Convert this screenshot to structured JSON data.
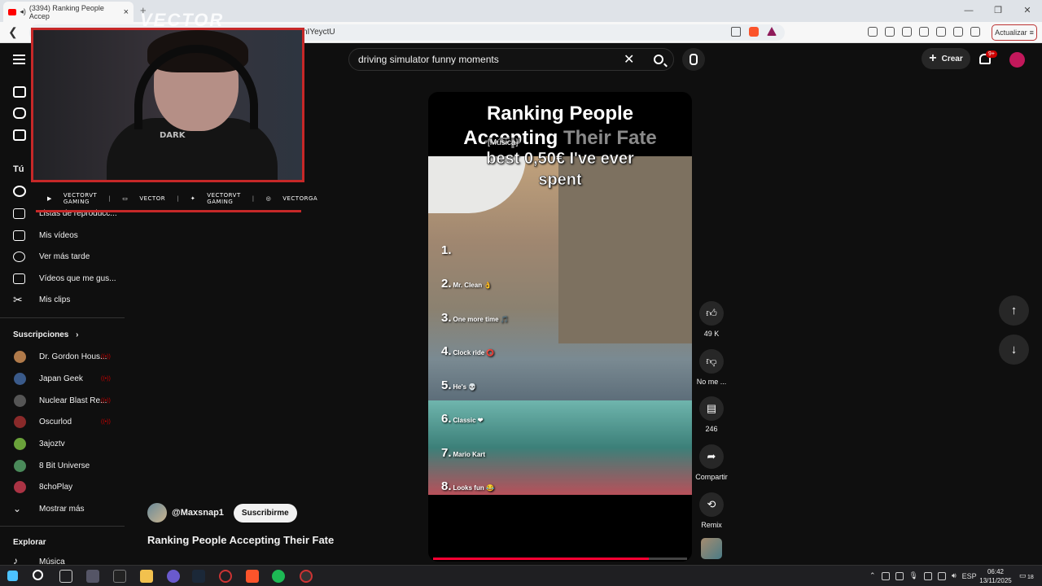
{
  "browser": {
    "tab_title": "(3394) Ranking People Accep",
    "url_fragment": "nIYeyctU",
    "update_label": "Actualizar",
    "new_tab": "+",
    "tab_close": "×"
  },
  "overlay": {
    "watermark": "VECTOR",
    "shirt_text": "DARK",
    "social": [
      "VECTORVT GAMING",
      "VECTOR",
      "VECTORVT GAMING",
      "VECTORGA"
    ]
  },
  "header": {
    "search_value": "driving simulator funny moments",
    "create_label": "Crear",
    "notif_badge": "9+"
  },
  "sidebar": {
    "tu_label": "Tú",
    "you_items": [
      {
        "label": "Listas de reproducc...",
        "icon": "playlist-icon"
      },
      {
        "label": "Mis vídeos",
        "icon": "video-icon"
      },
      {
        "label": "Ver más tarde",
        "icon": "clock-icon"
      },
      {
        "label": "Vídeos que me gus...",
        "icon": "thumb-up-icon"
      },
      {
        "label": "Mis clips",
        "icon": "scissors-icon"
      }
    ],
    "subs_label": "Suscripciones",
    "subscriptions": [
      {
        "name": "Dr. Gordon Hous...",
        "live": true,
        "color": "#b07a4a"
      },
      {
        "name": "Japan Geek",
        "live": true,
        "color": "#3a5a8a"
      },
      {
        "name": "Nuclear Blast Re...",
        "live": true,
        "color": "#555555"
      },
      {
        "name": "Oscurlod",
        "live": true,
        "color": "#8a2a2a"
      },
      {
        "name": "3ajoztv",
        "live": false,
        "color": "#6aa23a"
      },
      {
        "name": "8 Bit Universe",
        "live": false,
        "color": "#4a8a5a"
      },
      {
        "name": "8choPlay",
        "live": false,
        "color": "#aa3344"
      }
    ],
    "show_more": "Mostrar más",
    "explore_label": "Explorar",
    "explore_first": "Música"
  },
  "short": {
    "title_line1": "Ranking People",
    "title_line2_a": "Accepting",
    "title_line2_b": "Their Fate",
    "caption": "[Música]",
    "overlay_line1": "best 0,50€ I've ever",
    "overlay_line2": "spent",
    "ranks": [
      {
        "n": "1.",
        "t": ""
      },
      {
        "n": "2.",
        "t": "Mr. Clean 👌"
      },
      {
        "n": "3.",
        "t": "One more time 🎵"
      },
      {
        "n": "4.",
        "t": "Clock ride ⭕"
      },
      {
        "n": "5.",
        "t": "He's 💀"
      },
      {
        "n": "6.",
        "t": "Classic ❤"
      },
      {
        "n": "7.",
        "t": "Mario Kart"
      },
      {
        "n": "8.",
        "t": "Looks fun 😂"
      }
    ],
    "progress_fraction": 0.85
  },
  "actions": {
    "likes": "49 K",
    "dislike_label": "No me ...",
    "comments": "246",
    "share_label": "Compartir",
    "remix_label": "Remix"
  },
  "channel": {
    "handle": "@Maxsnap1",
    "subscribe_label": "Suscribirme"
  },
  "video_title": "Ranking People Accepting Their Fate",
  "taskbar": {
    "lang": "ESP",
    "time": "06:42",
    "date": "13/11/2025",
    "notif_count": "18"
  }
}
